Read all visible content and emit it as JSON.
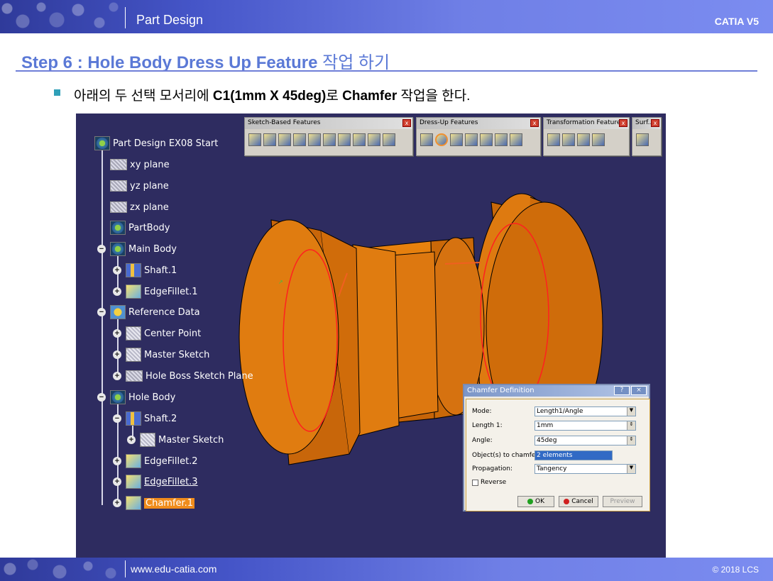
{
  "header": {
    "title": "Part Design",
    "brand": "CATIA V5"
  },
  "slide": {
    "step_title": "Step 6 : Hole Body Dress Up Feature",
    "step_title_kr": "작업 하기",
    "instr_pre": "아래의 두 선택 모서리에 ",
    "instr_bold1": "C1(1mm X 45deg)",
    "instr_mid": "로 ",
    "instr_bold2": "Chamfer",
    "instr_post": " 작업을 한다."
  },
  "tree": {
    "root": "Part Design EX08 Start",
    "items": [
      "xy plane",
      "yz plane",
      "zx plane",
      "PartBody",
      "Main Body",
      "Shaft.1",
      "EdgeFillet.1",
      "Reference Data",
      "Center Point",
      "Master Sketch",
      "Hole Boss Sketch Plane",
      "Hole Body",
      "Shaft.2",
      "Master Sketch",
      "EdgeFillet.2",
      "EdgeFillet.3",
      "Chamfer.1"
    ]
  },
  "toolbars": [
    {
      "title": "Sketch-Based Features"
    },
    {
      "title": "Dress-Up Features"
    },
    {
      "title": "Transformation Features"
    },
    {
      "title": "Surf..."
    }
  ],
  "dialog": {
    "title": "Chamfer Definition",
    "help": "?",
    "close": "×",
    "mode_label": "Mode:",
    "mode_value": "Length1/Angle",
    "length_label": "Length 1:",
    "length_value": "1mm",
    "angle_label": "Angle:",
    "angle_value": "45deg",
    "objects_label": "Object(s) to chamfer:",
    "objects_value": "2 elements",
    "propagation_label": "Propagation:",
    "propagation_value": "Tangency",
    "reverse_label": "Reverse",
    "ok": "OK",
    "cancel": "Cancel",
    "preview": "Preview"
  },
  "footer": {
    "url": "www.edu-catia.com",
    "copyright": "© 2018 LCS"
  },
  "colors": {
    "viewport_bg": "#2e2c60",
    "part": "#d8700c",
    "selection": "#f08c1c",
    "accent_title": "#5b79d6"
  }
}
